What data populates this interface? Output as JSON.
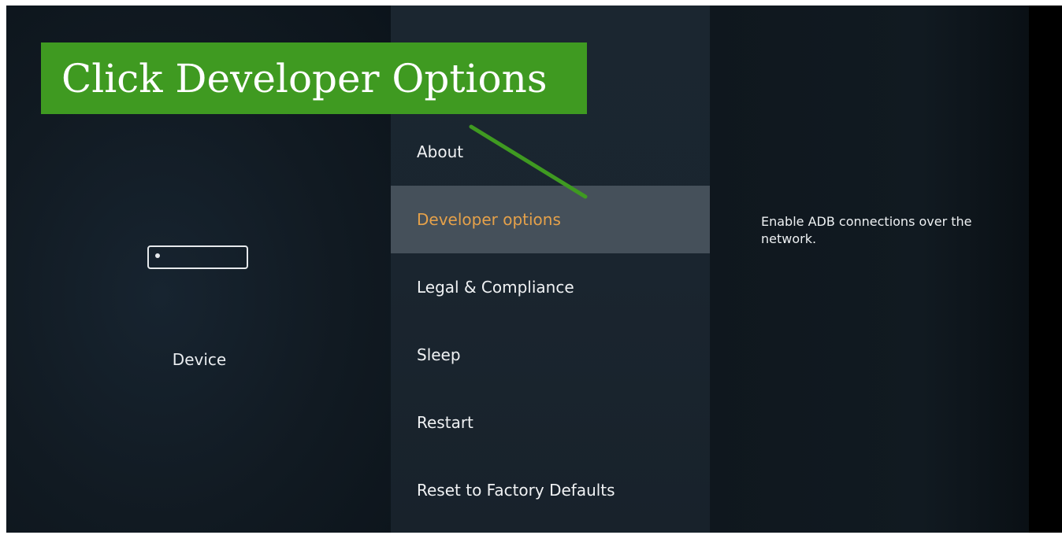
{
  "annotation": {
    "banner_text": "Click Developer Options",
    "banner_color": "#3f9a21"
  },
  "left_panel": {
    "device_label": "Device",
    "icon": "device-box-icon"
  },
  "menu": {
    "items": [
      {
        "label": "About",
        "selected": false
      },
      {
        "label": "Developer options",
        "selected": true
      },
      {
        "label": "Legal & Compliance",
        "selected": false
      },
      {
        "label": "Sleep",
        "selected": false
      },
      {
        "label": "Restart",
        "selected": false
      },
      {
        "label": "Reset to Factory Defaults",
        "selected": false
      }
    ],
    "selected_text_color": "#e5a14a",
    "selected_background": "#45505a"
  },
  "description": {
    "text": "Enable ADB connections over the network."
  }
}
